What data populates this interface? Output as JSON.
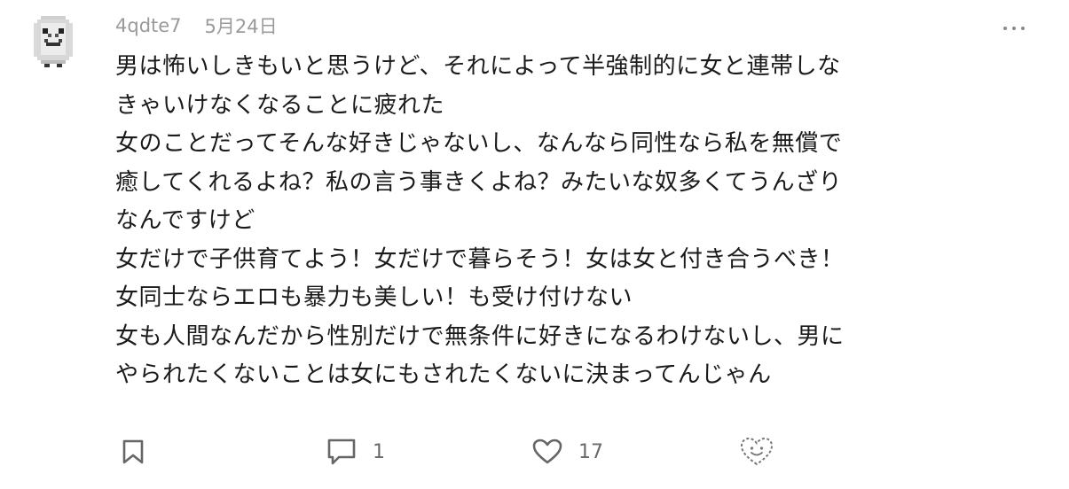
{
  "post": {
    "username": "4qdte7",
    "date": "5月24日",
    "more_icon": "more-horizontal-icon",
    "lines": [
      "男は怖いしきもいと思うけど、それによって半強制的に女と連帯しな",
      "きゃいけなくなることに疲れた",
      "女のことだってそんな好きじゃないし、なんなら同性なら私を無償で",
      "癒してくれるよね？私の言う事きくよね？みたいな奴多くてうんざり",
      "なんですけど",
      "女だけで子供育てよう！女だけで暮らそう！女は女と付き合うべき！",
      "女同士ならエロも暴力も美しい！も受け付けない",
      "女も人間なんだから性別だけで無条件に好きになるわけないし、男に",
      "やられたくないことは女にもされたくないに決まってんじゃん"
    ]
  },
  "actions": {
    "bookmark_icon": "bookmark-icon",
    "reply_icon": "comment-icon",
    "reply_count": "1",
    "like_icon": "heart-icon",
    "like_count": "17",
    "reaction_icon": "heart-smile-icon"
  },
  "colors": {
    "meta_text": "#9a9a9a",
    "body_text": "#1a1a1a",
    "icon": "#666666"
  }
}
